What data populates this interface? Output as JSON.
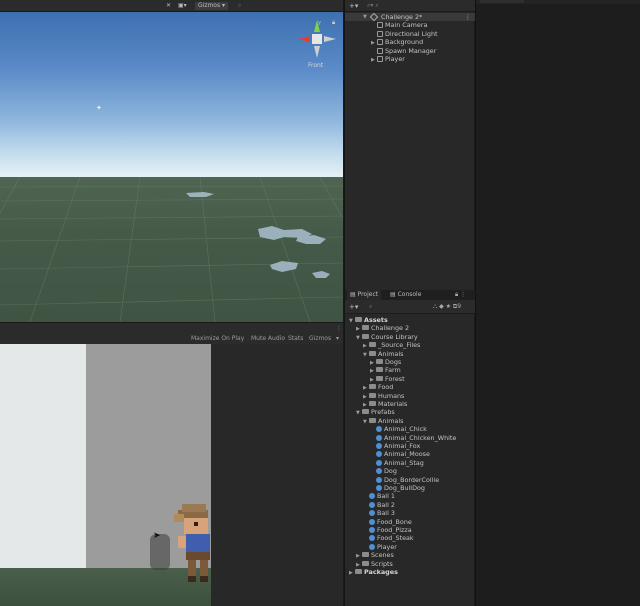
{
  "scene": {
    "toolbar": {
      "gizmos_label": "Gizmos"
    },
    "gizmo_label": "Front"
  },
  "game": {
    "toolbar": {
      "maximize": "Maximize On Play",
      "mute": "Mute Audio",
      "stats": "Stats",
      "gizmos": "Gizmos"
    }
  },
  "hierarchy": {
    "root": "Challenge 2*",
    "items": [
      "Main Camera",
      "Directional Light",
      "Background",
      "Spawn Manager",
      "Player"
    ]
  },
  "project": {
    "tabs": [
      "Project",
      "Console"
    ],
    "tree": [
      {
        "label": "Assets",
        "depth": 0,
        "type": "root",
        "expanded": true
      },
      {
        "label": "Challenge 2",
        "depth": 1,
        "type": "folder",
        "expanded": false
      },
      {
        "label": "Course Library",
        "depth": 1,
        "type": "folder",
        "expanded": true
      },
      {
        "label": "_Source_Files",
        "depth": 2,
        "type": "folder",
        "expanded": false
      },
      {
        "label": "Animals",
        "depth": 2,
        "type": "folder",
        "expanded": true
      },
      {
        "label": "Dogs",
        "depth": 3,
        "type": "folder",
        "expanded": false
      },
      {
        "label": "Farm",
        "depth": 3,
        "type": "folder",
        "expanded": false
      },
      {
        "label": "Forest",
        "depth": 3,
        "type": "folder",
        "expanded": false
      },
      {
        "label": "Food",
        "depth": 2,
        "type": "folder",
        "expanded": false
      },
      {
        "label": "Humans",
        "depth": 2,
        "type": "folder",
        "expanded": false
      },
      {
        "label": "Materials",
        "depth": 2,
        "type": "folder",
        "expanded": false
      },
      {
        "label": "Prefabs",
        "depth": 1,
        "type": "folder",
        "expanded": true
      },
      {
        "label": "Animals",
        "depth": 2,
        "type": "folder",
        "expanded": true
      },
      {
        "label": "Animal_Chick",
        "depth": 3,
        "type": "prefab"
      },
      {
        "label": "Animal_Chicken_White",
        "depth": 3,
        "type": "prefab"
      },
      {
        "label": "Animal_Fox",
        "depth": 3,
        "type": "prefab"
      },
      {
        "label": "Animal_Moose",
        "depth": 3,
        "type": "prefab"
      },
      {
        "label": "Animal_Stag",
        "depth": 3,
        "type": "prefab"
      },
      {
        "label": "Dog",
        "depth": 3,
        "type": "prefab"
      },
      {
        "label": "Dog_BorderCollie",
        "depth": 3,
        "type": "prefab"
      },
      {
        "label": "Dog_BullDog",
        "depth": 3,
        "type": "prefab"
      },
      {
        "label": "Ball 1",
        "depth": 2,
        "type": "prefab"
      },
      {
        "label": "Ball 2",
        "depth": 2,
        "type": "prefab"
      },
      {
        "label": "Ball 3",
        "depth": 2,
        "type": "prefab"
      },
      {
        "label": "Food_Bone",
        "depth": 2,
        "type": "prefab"
      },
      {
        "label": "Food_Pizza",
        "depth": 2,
        "type": "prefab"
      },
      {
        "label": "Food_Steak",
        "depth": 2,
        "type": "prefab"
      },
      {
        "label": "Player",
        "depth": 2,
        "type": "prefab"
      },
      {
        "label": "Scenes",
        "depth": 1,
        "type": "folder",
        "expanded": false
      },
      {
        "label": "Scripts",
        "depth": 1,
        "type": "folder",
        "expanded": false
      },
      {
        "label": "Packages",
        "depth": 0,
        "type": "root",
        "expanded": false
      }
    ]
  }
}
